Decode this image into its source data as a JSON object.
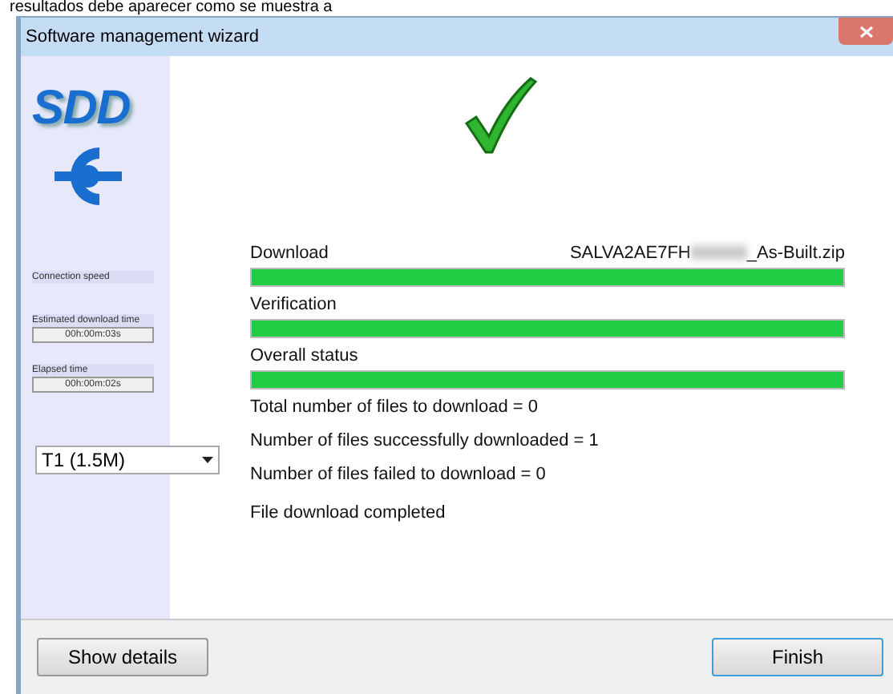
{
  "document_text": "resultados debe aparecer como se muestra a",
  "window": {
    "title": "Software management wizard"
  },
  "sidebar": {
    "logo": "SDD",
    "connection_speed": {
      "label": "Connection speed"
    },
    "estimated_time": {
      "label": "Estimated download time",
      "value": "00h:00m:03s"
    },
    "elapsed_time": {
      "label": "Elapsed time",
      "value": "00h:00m:02s"
    },
    "speed_dropdown": {
      "value": "T1 (1.5M)"
    }
  },
  "progress": [
    {
      "label": "Download",
      "file_start": "SALVA2AE7FH",
      "file_end": "_As-Built.zip",
      "level": 1
    },
    {
      "label": "Verification",
      "level": 1
    },
    {
      "label": "Overall status",
      "level": 1
    }
  ],
  "summary": [
    "Total number of files to download = 0",
    "Number of files successfully downloaded = 1",
    "Number of files failed to download = 0"
  ],
  "status": "File download completed",
  "buttons": [
    {
      "label": "Show details",
      "default": false
    },
    {
      "label": "Finish",
      "default": true
    }
  ]
}
